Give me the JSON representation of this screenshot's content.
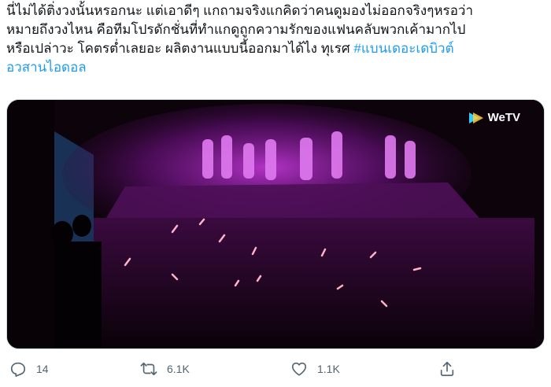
{
  "tweet": {
    "text_line1": "นี่ไม่ได้ติ่งวงนั้นหรอกนะ แต่เอาดีๆ แกถามจริงแกคิดว่าคนดูมองไม่ออกจริงๆหรอว่า",
    "text_line2": "หมายถึงวงไหน คือทีมโปรดักชั่นที่ทำแกดูถูกความรักของแฟนคลับพวกเค้ามากไป",
    "text_line3_prefix": "หรือเปล่าวะ โคตรต่ำเลยอะ ผลิตงานแบบนี้ออกมาได้ไง ทุเรศ ",
    "hashtag_part1": "#แบนเดอะเดบิวต์",
    "hashtag_part2": "อวสานไอดอล"
  },
  "media": {
    "watermark": "WeTV",
    "accent_color": "#c02ad8"
  },
  "actions": {
    "reply_count": "14",
    "retweet_count": "6.1K",
    "like_count": "1.1K"
  },
  "icons": [
    "reply-icon",
    "retweet-icon",
    "like-icon",
    "share-icon",
    "wetv-logo-icon"
  ]
}
